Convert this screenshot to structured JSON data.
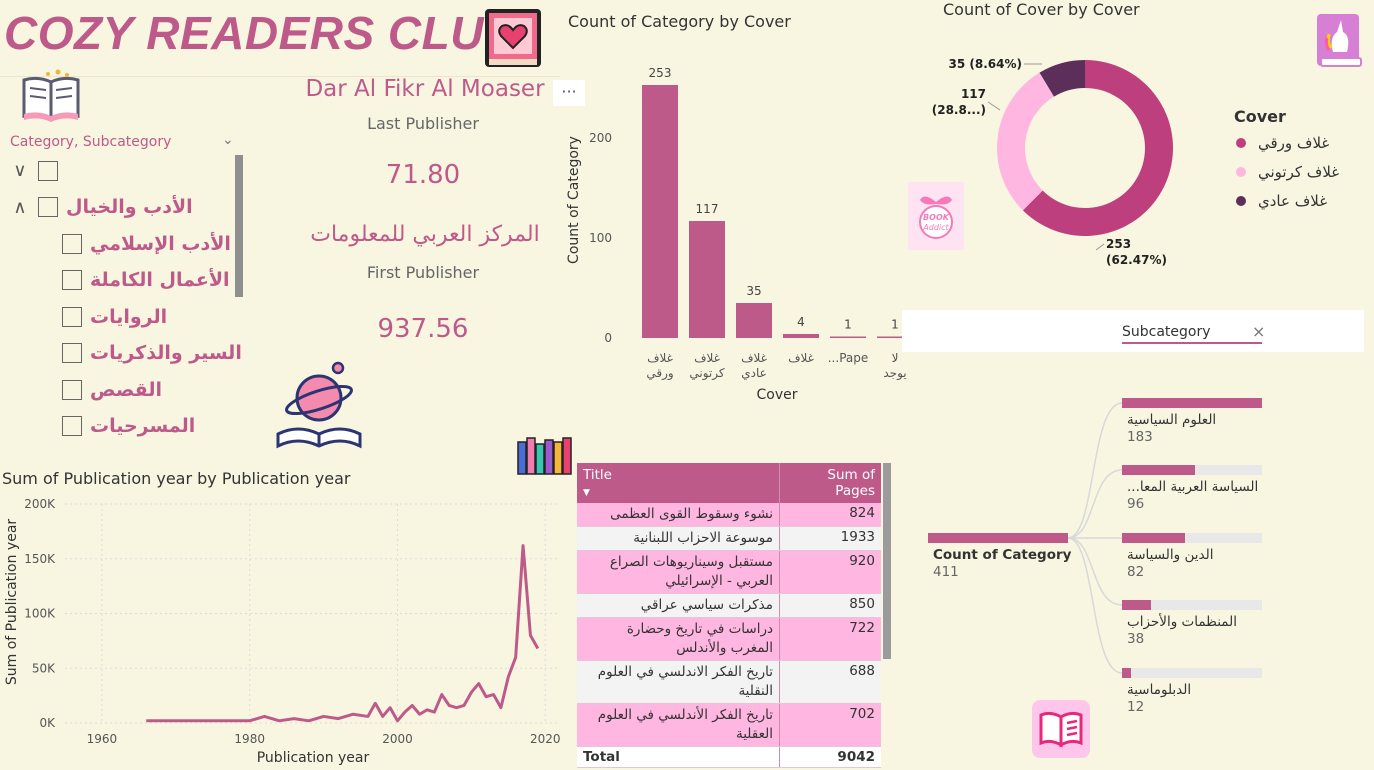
{
  "header": {
    "title": "COZY READERS CLUB"
  },
  "slicer": {
    "title": "Category, Subcategory",
    "items": [
      {
        "label": "",
        "level": 0,
        "expander": "expand"
      },
      {
        "label": "الأدب والخيال",
        "level": 0,
        "expander": "collapse"
      },
      {
        "label": "الأدب الإسلامي",
        "level": 1
      },
      {
        "label": "الأعمال الكاملة",
        "level": 1
      },
      {
        "label": "الروايات",
        "level": 1
      },
      {
        "label": "السير والذكريات",
        "level": 1
      },
      {
        "label": "القصص",
        "level": 1
      },
      {
        "label": "المسرحيات",
        "level": 1
      }
    ]
  },
  "cards": {
    "last_publisher_name": "Dar Al Fikr Al Moaser",
    "last_publisher_label": "Last Publisher",
    "last_value": "71.80",
    "first_publisher_name": "المركز العربي للمعلومات",
    "first_publisher_label": "First Publisher",
    "first_value": "937.56",
    "more_label": "···"
  },
  "icons": {
    "book_heart": "book-heart-icon",
    "open_book": "open-book-icon",
    "unicorn_book": "unicorn-book-icon",
    "book_addict": "book-addict-sticker",
    "planet_book": "planet-book-icon",
    "bookshelf": "bookshelf-icon",
    "reading_book": "reading-book-icon",
    "book_addict_text": "BOOK Addict"
  },
  "colors": {
    "accent": "#be5a8a",
    "light_pink": "#ffb6e1",
    "dark_plum": "#5c2e5a",
    "background": "#f8f6e1"
  },
  "chart_data": [
    {
      "type": "bar",
      "title": "Count of Category by Cover",
      "xlabel": "Cover",
      "ylabel": "Count of Category",
      "categories": [
        "غلاف ورقي",
        "غلاف كرتوني",
        "غلاف عادي",
        "غلاف",
        "Pape...",
        "لا يوجد"
      ],
      "values": [
        253,
        117,
        35,
        4,
        1,
        1
      ],
      "yticks": [
        0,
        100,
        200
      ],
      "ylim": [
        0,
        260
      ],
      "grid": false
    },
    {
      "type": "pie",
      "title": "Count of Cover by Cover",
      "legend_title": "Cover",
      "legend_position": "right",
      "slices": [
        {
          "name": "غلاف ورقي",
          "value": 253,
          "label": "253\n(62.47%)",
          "color": "#be3f7e"
        },
        {
          "name": "غلاف كرتوني",
          "value": 117,
          "label": "117\n(28.8...)",
          "color": "#ffb6e1"
        },
        {
          "name": "غلاف عادي",
          "value": 35,
          "label": "35 (8.64%)",
          "color": "#5c2e5a"
        }
      ]
    },
    {
      "type": "line",
      "title": "Sum of Publication year by Publication year",
      "xlabel": "Publication year",
      "ylabel": "Sum of Publication year",
      "xlim": [
        1955,
        2022
      ],
      "ylim": [
        0,
        200000
      ],
      "xticks": [
        1960,
        1980,
        2000,
        2020
      ],
      "yticks": [
        0,
        50000,
        100000,
        150000,
        200000
      ],
      "ytick_labels": [
        "0K",
        "50K",
        "100K",
        "150K",
        "200K"
      ],
      "grid": true,
      "x": [
        1966,
        1968,
        1970,
        1972,
        1974,
        1976,
        1978,
        1980,
        1982,
        1984,
        1986,
        1988,
        1990,
        1992,
        1994,
        1996,
        1997,
        1998,
        1999,
        2000,
        2001,
        2002,
        2003,
        2004,
        2005,
        2006,
        2007,
        2008,
        2009,
        2010,
        2011,
        2012,
        2013,
        2014,
        2015,
        2016,
        2017,
        2018,
        2019
      ],
      "y": [
        2000,
        2000,
        2000,
        2000,
        2000,
        2000,
        2000,
        2000,
        6000,
        2000,
        4000,
        2000,
        6000,
        4000,
        8000,
        6000,
        18000,
        6000,
        14000,
        2000,
        10000,
        16000,
        8000,
        12000,
        10000,
        26000,
        16000,
        14000,
        16000,
        28000,
        36000,
        24000,
        26000,
        14000,
        42000,
        60000,
        162000,
        80000,
        68000
      ]
    },
    {
      "type": "table",
      "columns": [
        "Title",
        "Sum of Pages"
      ],
      "rows": [
        [
          "نشوء وسقوط القوى العظمى",
          "824"
        ],
        [
          "موسوعة الاحزاب اللبنانية",
          "1933"
        ],
        [
          "مستقبل وسيناريوهات الصراع العربي - الإسرائيلي",
          "920"
        ],
        [
          "مذكرات سياسي عراقي",
          "850"
        ],
        [
          "دراسات في تاريخ وحضارة المغرب والأندلس",
          "722"
        ],
        [
          "تاريخ الفكر الاندلسي في العلوم النقلية",
          "688"
        ],
        [
          "تاريخ الفكر الأندلسي في العلوم العقلية",
          "702"
        ]
      ],
      "total_label": "Total",
      "total_value": "9042"
    },
    {
      "type": "bar",
      "title": "",
      "filter_label": "Subcategory",
      "root": {
        "label": "Count of Category",
        "value": 411
      },
      "categories": [
        "العلوم السياسية",
        "السياسة العربية المعا...",
        "الدين والسياسة",
        "المنظمات والأحزاب",
        "الدبلوماسية"
      ],
      "values": [
        183,
        96,
        82,
        38,
        12
      ]
    }
  ]
}
